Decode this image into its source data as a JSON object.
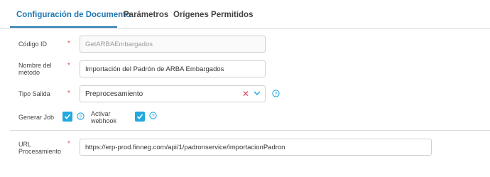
{
  "tabs": [
    {
      "label": "Configuración de Documento"
    },
    {
      "label": "Parámetros"
    },
    {
      "label": "Orígenes Permitidos"
    }
  ],
  "form": {
    "codigo_id": {
      "label": "Código ID",
      "required": "*",
      "value": "GetARBAEmbargados"
    },
    "nombre_metodo": {
      "label_line1": "Nombre del",
      "label_line2": "método",
      "required": "*",
      "value": "Importación del Padrón de ARBA Embargados"
    },
    "tipo_salida": {
      "label": "Tipo Salida",
      "required": "*",
      "selected": "Preprocesamiento"
    },
    "generar_job": {
      "label": "Generar Job",
      "checked": true
    },
    "activar_webhook": {
      "label_line1": "Activar",
      "label_line2": "webhook",
      "checked": true
    },
    "url_procesamiento": {
      "label_line1": "URL",
      "label_line2": "Procesamiento",
      "required": "*",
      "value": "https://erp-prod.finneg.com/api/1/padronservice/importacionPadron"
    }
  },
  "colors": {
    "accent": "#1f78b4",
    "checkbox": "#23a8e0",
    "required": "#d9534f",
    "clear": "#e0405a"
  },
  "icons": [
    "clear-icon",
    "chevron-down-icon",
    "help-icon",
    "check-icon"
  ]
}
